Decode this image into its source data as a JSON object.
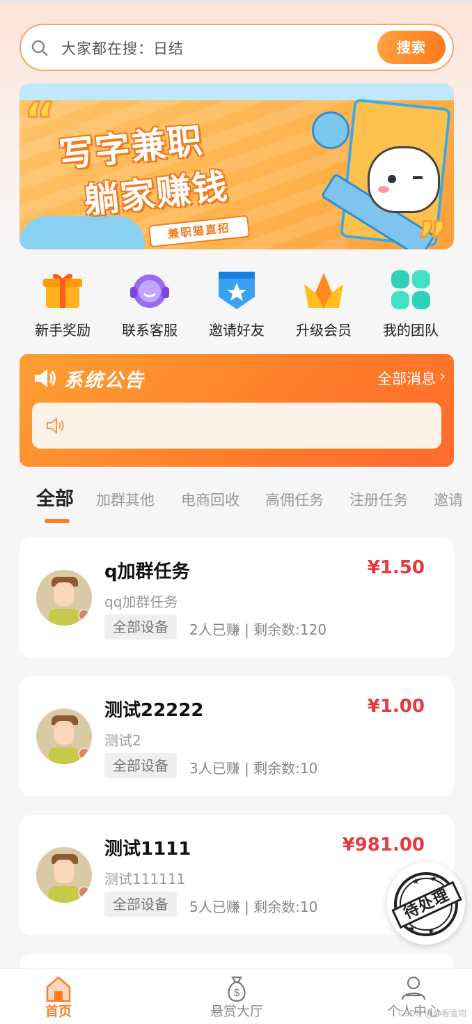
{
  "search": {
    "placeholder": "大家都在搜：日结",
    "button_label": "搜索"
  },
  "banner": {
    "title_line1": "写字兼职",
    "title_line2": "躺家赚钱",
    "tag": "兼职猫直招"
  },
  "quick_menu": [
    {
      "label": "新手奖励",
      "icon": "gift-icon",
      "color": "#ffb21e"
    },
    {
      "label": "联系客服",
      "icon": "headset-icon",
      "color": "#9a6bf0"
    },
    {
      "label": "邀请好友",
      "icon": "star-badge-icon",
      "color": "#3aa2f5"
    },
    {
      "label": "升级会员",
      "icon": "crown-icon",
      "color": "#ffbf1f"
    },
    {
      "label": "我的团队",
      "icon": "grid-icon",
      "color": "#2fd2b6"
    }
  ],
  "notice": {
    "title": "系统公告",
    "all_label": "全部消息",
    "message": ""
  },
  "tabs": [
    {
      "label": "全部",
      "active": true
    },
    {
      "label": "加群其他"
    },
    {
      "label": "电商回收"
    },
    {
      "label": "高佣任务"
    },
    {
      "label": "注册任务"
    },
    {
      "label": "邀请"
    }
  ],
  "tasks": [
    {
      "title": "q加群任务",
      "price": "¥1.50",
      "subtitle": "qq加群任务",
      "device": "全部设备",
      "stats": "2人已赚 | 剩余数:120"
    },
    {
      "title": "测试22222",
      "price": "¥1.00",
      "subtitle": "测试2",
      "device": "全部设备",
      "stats": "3人已赚 | 剩余数:10"
    },
    {
      "title": "测试1111",
      "price": "¥981.00",
      "subtitle": "测试111111",
      "device": "全部设备",
      "stats": "5人已赚 | 剩余数:10"
    }
  ],
  "stamp": {
    "label": "待处理"
  },
  "nav": [
    {
      "label": "首页",
      "icon": "home-icon",
      "active": true
    },
    {
      "label": "悬赏大厅",
      "icon": "money-bag-icon"
    },
    {
      "label": "个人中心",
      "icon": "user-icon"
    }
  ],
  "watermark": "CSDN @静看雪雨",
  "colors": {
    "accent": "#ff7b24",
    "price": "#e6383d"
  }
}
